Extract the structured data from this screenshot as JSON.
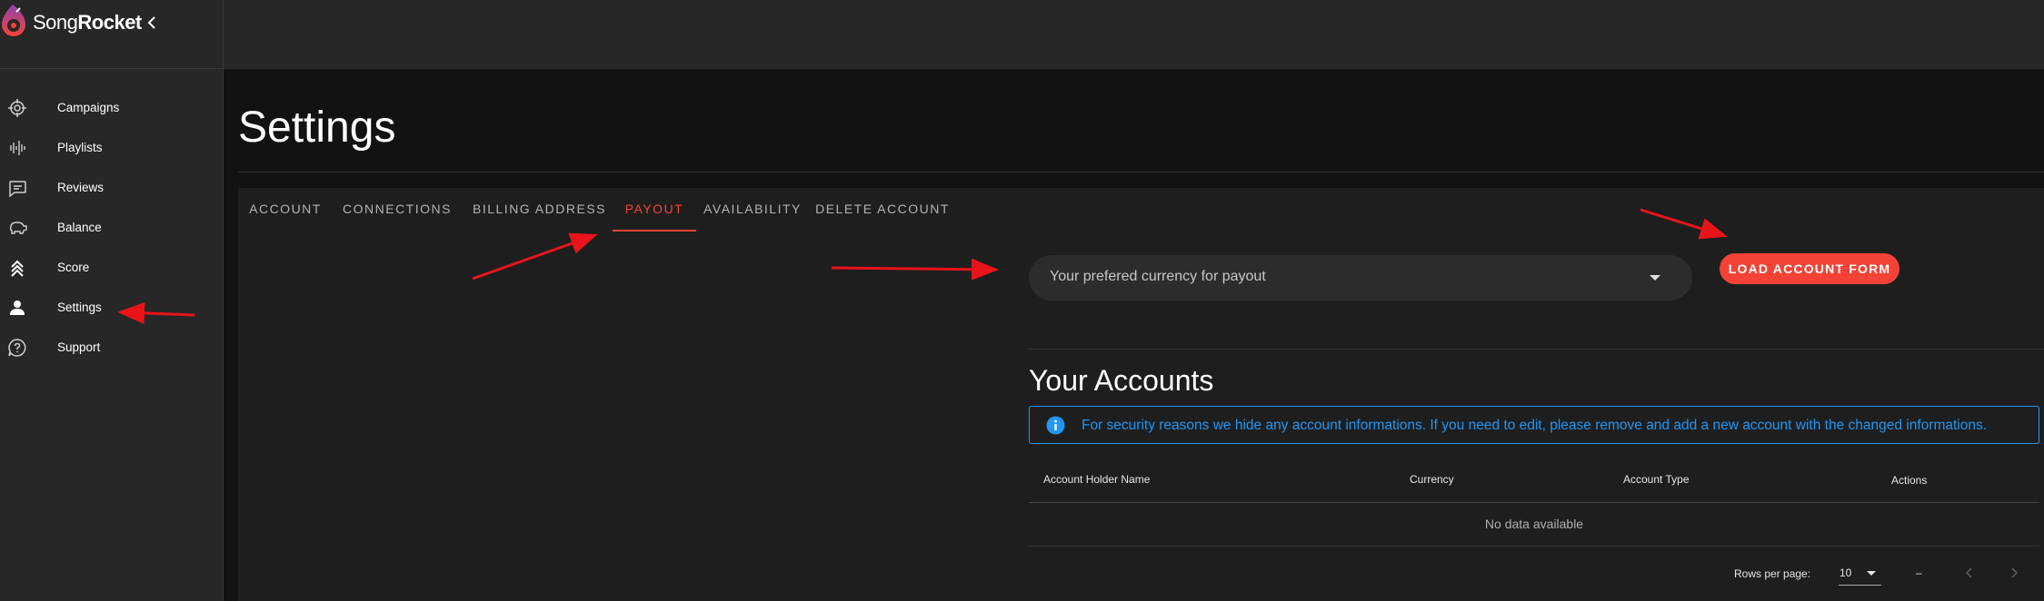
{
  "brand": {
    "name_light": "Song",
    "name_bold": "Rocket"
  },
  "nav": {
    "items": [
      {
        "label": "Campaigns",
        "icon": "target-icon"
      },
      {
        "label": "Playlists",
        "icon": "waveform-icon"
      },
      {
        "label": "Reviews",
        "icon": "chat-icon"
      },
      {
        "label": "Balance",
        "icon": "piggy-bank-icon"
      },
      {
        "label": "Score",
        "icon": "chevrons-up-icon"
      },
      {
        "label": "Settings",
        "icon": "person-icon"
      },
      {
        "label": "Support",
        "icon": "help-circle-icon"
      }
    ]
  },
  "page": {
    "title": "Settings"
  },
  "tabs": [
    {
      "label": "ACCOUNT"
    },
    {
      "label": "CONNECTIONS"
    },
    {
      "label": "BILLING ADDRESS"
    },
    {
      "label": "PAYOUT",
      "active": true
    },
    {
      "label": "AVAILABILITY"
    },
    {
      "label": "DELETE ACCOUNT"
    }
  ],
  "payout": {
    "currency_placeholder": "Your prefered currency for payout",
    "load_button": "LOAD ACCOUNT FORM"
  },
  "accounts": {
    "title": "Your Accounts",
    "alert": "For security reasons we hide any account informations. If you need to edit, please remove and add a new account with the changed informations.",
    "columns": [
      "Account Holder Name",
      "Currency",
      "Account Type",
      "Actions"
    ],
    "empty": "No data available",
    "footer": {
      "rows_per_page_label": "Rows per page:",
      "rows_per_page_value": "10",
      "range": "–"
    }
  },
  "colors": {
    "accent": "#f44336",
    "info": "#2196f3",
    "sidebar": "#272727",
    "background": "#121212"
  }
}
